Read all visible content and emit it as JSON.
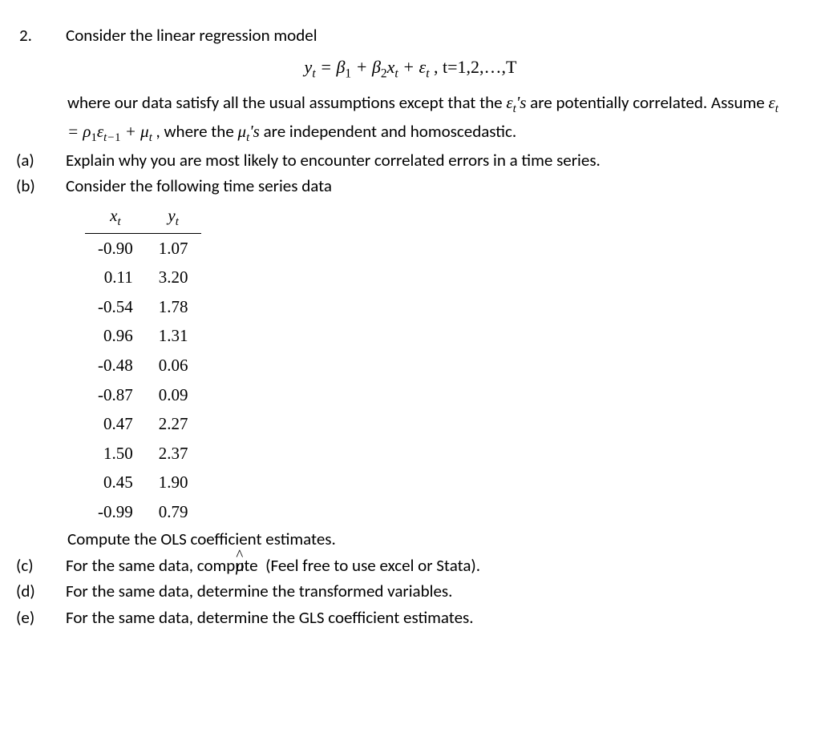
{
  "question": {
    "number": "2.",
    "intro": "Consider the linear regression model",
    "equation_html": "y<span class='sub'>t</span> = β<span class='subn'>1</span> + β<span class='subn'>2</span>x<span class='sub'>t</span> + ε<span class='sub'>t</span> <span class='nonit'>,</span> <span class='nonit'>t=1,2,…,T</span>",
    "body1_pre": "where our data satisfy all the usual assumptions except that the ",
    "body1_eps": "ε<span class='sub'>t</span>'s",
    "body1_post": " are potentially correlated. Assume ",
    "body1_eq": "ε<span class='sub'>t</span> = ρ<span class='subn'>1</span>ε<span class='sub'>t−<span class='nonit'>1</span></span> + μ<span class='sub'>t</span>",
    "body1_post2": " , where the ",
    "body1_mu": "μ<span class='sub'>t</span>'s",
    "body1_post3": " are independent and homoscedastic."
  },
  "parts": {
    "a": {
      "label": "(a)",
      "text": "Explain why you are most likely to encounter correlated errors in a time series."
    },
    "b": {
      "label": "(b)",
      "text": "Consider the following time series data",
      "after": "Compute the OLS coefficient estimates."
    },
    "c": {
      "label": "(c)",
      "text_pre": "For the same data, compute ",
      "rho": "ρ",
      "text_post": " (Feel free to use excel or Stata)."
    },
    "d": {
      "label": "(d)",
      "text": "For the same data, determine the transformed variables."
    },
    "e": {
      "label": "(e)",
      "text": "For the same data, determine the GLS coefficient estimates."
    }
  },
  "table": {
    "headers": {
      "x": "x",
      "xsub": "t",
      "y": "y",
      "ysub": "t"
    },
    "rows": [
      {
        "x": "-0.90",
        "y": "1.07"
      },
      {
        "x": "0.11",
        "y": "3.20"
      },
      {
        "x": "-0.54",
        "y": "1.78"
      },
      {
        "x": "0.96",
        "y": "1.31"
      },
      {
        "x": "-0.48",
        "y": "0.06"
      },
      {
        "x": "-0.87",
        "y": "0.09"
      },
      {
        "x": "0.47",
        "y": "2.27"
      },
      {
        "x": "1.50",
        "y": "2.37"
      },
      {
        "x": "0.45",
        "y": "1.90"
      },
      {
        "x": "-0.99",
        "y": "0.79"
      }
    ]
  }
}
